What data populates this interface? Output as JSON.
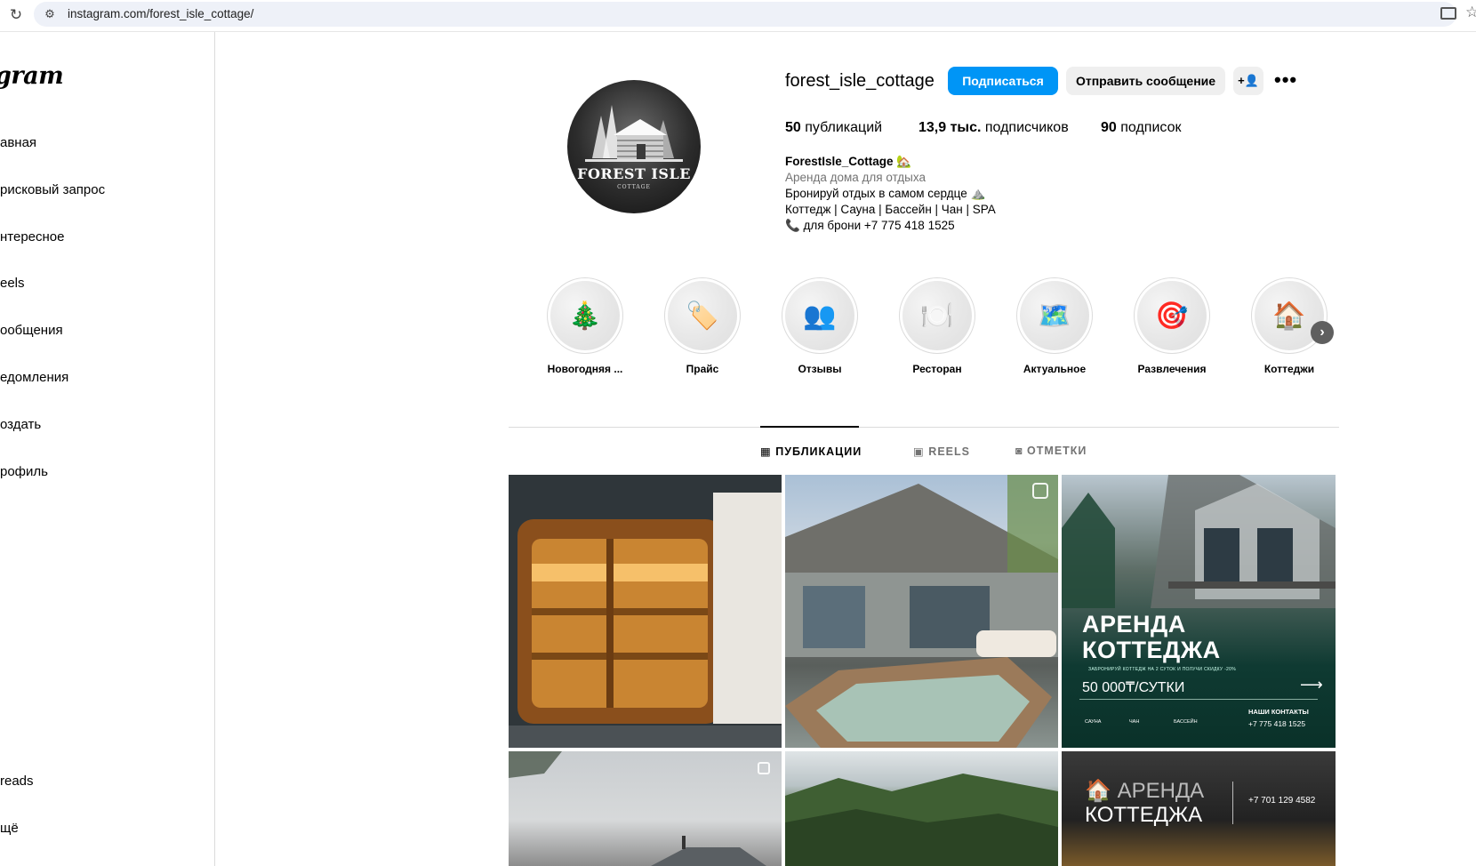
{
  "browser": {
    "url": "instagram.com/forest_isle_cottage/"
  },
  "sidebar": {
    "logo": "gram",
    "items": [
      {
        "label": "авная"
      },
      {
        "label": "рисковый запрос"
      },
      {
        "label": "нтересное"
      },
      {
        "label": "eels"
      },
      {
        "label": "ообщения"
      },
      {
        "label": "едомления"
      },
      {
        "label": "оздать"
      },
      {
        "label": "рофиль"
      },
      {
        "label": "reads"
      },
      {
        "label": "щё"
      }
    ]
  },
  "profile": {
    "username": "forest_isle_cottage",
    "follow_label": "Подписаться",
    "message_label": "Отправить сообщение",
    "add_user_glyph": "+👤",
    "more_glyph": "•••",
    "avatar_title": "FOREST ISLE",
    "avatar_subtitle": "COTTAGE",
    "stats": {
      "posts_count": "50",
      "posts_label": " публикаций",
      "followers_count": "13,9 тыс.",
      "followers_label": " подписчиков",
      "following_count": "90",
      "following_label": " подписок"
    },
    "bio": {
      "name": "ForestIsle_Cottage 🏡",
      "category": "Аренда дома для отдыха",
      "line1": "Бронируй отдых в самом сердце ⛰️",
      "line2": "Коттедж | Сауна | Бассейн | Чан | SPA",
      "line3": "📞 для брони    +7 775 418 1525"
    }
  },
  "highlights": [
    {
      "label": "Новогодняя ...",
      "glyph": "🎄"
    },
    {
      "label": "Прайс",
      "glyph": "🏷️"
    },
    {
      "label": "Отзывы",
      "glyph": "👥"
    },
    {
      "label": "Ресторан",
      "glyph": "🍽️"
    },
    {
      "label": "Актуальное",
      "glyph": "🗺️"
    },
    {
      "label": "Развлечения",
      "glyph": "🎯"
    },
    {
      "label": "Коттеджи",
      "glyph": "🏠"
    }
  ],
  "tabs": [
    {
      "label": "ПУБЛИКАЦИИ",
      "icon": "▦"
    },
    {
      "label": "REELS",
      "icon": "▣"
    },
    {
      "label": "ОТМЕТКИ",
      "icon": "◙"
    }
  ],
  "posts": {
    "p3": {
      "title": "АРЕНДА\nКОТТЕДЖА",
      "small": "ЗАБРОНИРУЙ КОТТЕДЖ НА 2 СУТОК И ПОЛУЧИ СКИДКУ -20%",
      "price": "50 000₸/СУТКИ",
      "contacts": "НАШИ КОНТАКТЫ",
      "phone": "+7 775 418 1525",
      "amenities": [
        "САУНА",
        "ЧАН",
        "БАССЕЙН"
      ]
    },
    "p6": {
      "title1": "АРЕНДА",
      "title2": "КОТТЕДЖА",
      "phone": "+7 701 129 4582"
    }
  }
}
